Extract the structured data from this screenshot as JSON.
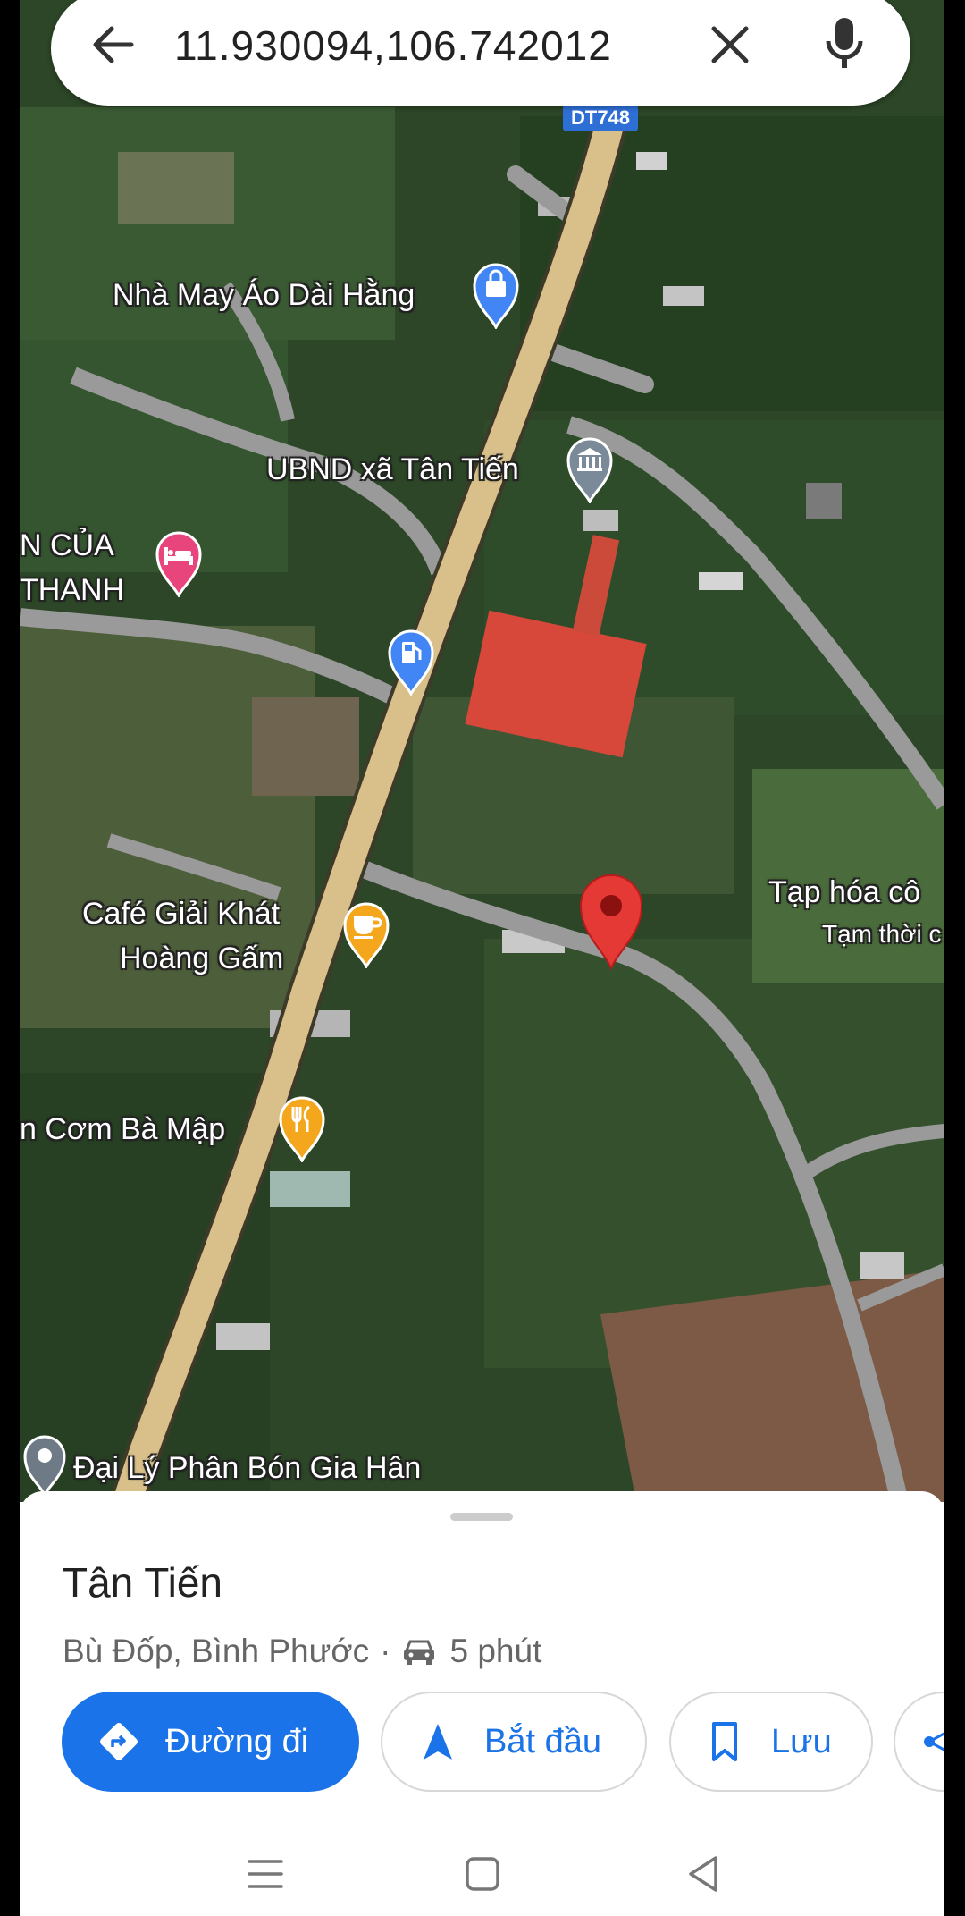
{
  "search": {
    "query": "11.930094,106.742012",
    "back_icon": "arrow-left-icon",
    "clear_icon": "close-icon",
    "mic_icon": "mic-icon"
  },
  "map": {
    "road_badge": "DT748",
    "labels": {
      "tailor": "Nhà May Áo Dài Hằng",
      "ubnd": "UBND xã Tân Tiến",
      "hotel_line1": "N CỦA",
      "hotel_line2": "THANH",
      "cafe_line1": "Café Giải Khát",
      "cafe_line2": "Hoàng Gấm",
      "com": "n Cơm Bà Mập",
      "taphoa": "Tạp hóa cô",
      "taphoa_status": "Tạm thời c",
      "fertilizer": "Đại Lý Phân Bón Gia Hân"
    },
    "colors": {
      "main_road": "#d9c08a",
      "side_road": "#9a9a9a",
      "selected_pin": "#e53935",
      "shopping_pin": "#4285f4",
      "gov_pin": "#7a8a99",
      "hotel_pin": "#e8457c",
      "food_pin": "#f4a61c",
      "gas_pin": "#4285f4"
    }
  },
  "place": {
    "title": "Tân Tiến",
    "region": "Bù Đốp, Bình Phước",
    "separator": "·",
    "drive_time": "5 phút"
  },
  "actions": {
    "directions": "Đường đi",
    "start": "Bắt đầu",
    "save": "Lưu"
  },
  "accent": "#1a73e8"
}
